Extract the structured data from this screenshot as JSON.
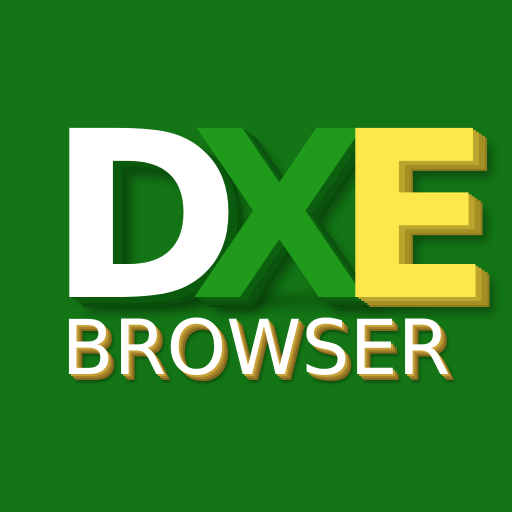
{
  "logo": {
    "letters": {
      "d": "D",
      "x": "X",
      "e": "E"
    },
    "subtitle": "BROWSER"
  },
  "colors": {
    "background": "#137515",
    "letter_d": "#ffffff",
    "letter_x": "#1f9a1a",
    "letter_e": "#fce84a",
    "subtitle": "#ffffff"
  }
}
